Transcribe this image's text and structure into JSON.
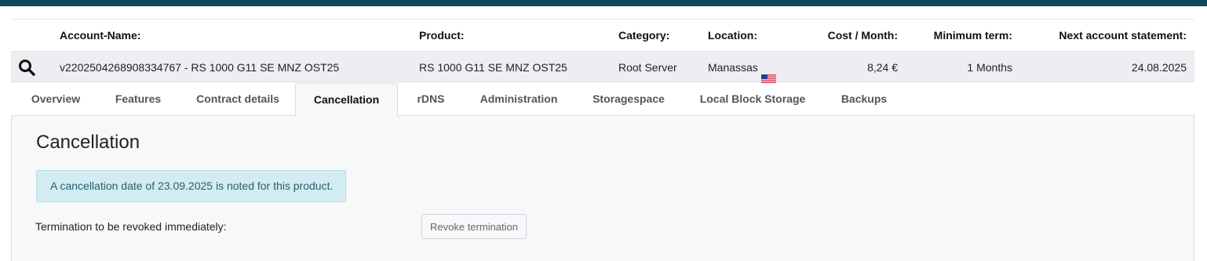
{
  "table": {
    "headers": {
      "account_name": "Account-Name:",
      "product": "Product:",
      "category": "Category:",
      "location": "Location:",
      "cost": "Cost / Month:",
      "minimum_term": "Minimum term:",
      "next_statement": "Next account statement:"
    },
    "row": {
      "account_name": "v2202504268908334767 - RS 1000 G11 SE MNZ OST25",
      "product": "RS 1000 G11 SE MNZ OST25",
      "category": "Root Server",
      "location": "Manassas",
      "location_flag_icon": "us-flag-icon",
      "cost": "8,24 €",
      "minimum_term": "1 Months",
      "next_statement": "24.08.2025"
    },
    "search_icon": "search-icon"
  },
  "tabs": [
    {
      "label": "Overview",
      "active": false
    },
    {
      "label": "Features",
      "active": false
    },
    {
      "label": "Contract details",
      "active": false
    },
    {
      "label": "Cancellation",
      "active": true
    },
    {
      "label": "rDNS",
      "active": false
    },
    {
      "label": "Administration",
      "active": false
    },
    {
      "label": "Storagespace",
      "active": false
    },
    {
      "label": "Local Block Storage",
      "active": false
    },
    {
      "label": "Backups",
      "active": false
    }
  ],
  "cancellation": {
    "title": "Cancellation",
    "notice": "A cancellation date of 23.09.2025 is noted for this product.",
    "revoke_label": "Termination to be revoked immediately:",
    "revoke_button": "Revoke termination"
  },
  "colors": {
    "topbar": "#0b4a5a",
    "alert_bg": "#d2ecf2",
    "alert_text": "#26616e"
  }
}
